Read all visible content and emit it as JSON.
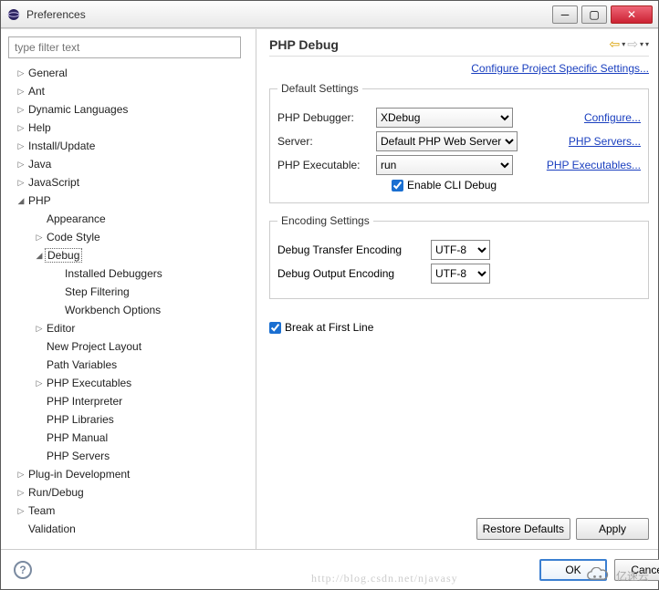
{
  "window": {
    "title": "Preferences"
  },
  "filter": {
    "placeholder": "type filter text"
  },
  "tree": [
    {
      "label": "General",
      "depth": 0,
      "arrow": "▷"
    },
    {
      "label": "Ant",
      "depth": 0,
      "arrow": "▷"
    },
    {
      "label": "Dynamic Languages",
      "depth": 0,
      "arrow": "▷"
    },
    {
      "label": "Help",
      "depth": 0,
      "arrow": "▷"
    },
    {
      "label": "Install/Update",
      "depth": 0,
      "arrow": "▷"
    },
    {
      "label": "Java",
      "depth": 0,
      "arrow": "▷"
    },
    {
      "label": "JavaScript",
      "depth": 0,
      "arrow": "▷"
    },
    {
      "label": "PHP",
      "depth": 0,
      "arrow": "◢"
    },
    {
      "label": "Appearance",
      "depth": 1,
      "arrow": ""
    },
    {
      "label": "Code Style",
      "depth": 1,
      "arrow": "▷"
    },
    {
      "label": "Debug",
      "depth": 1,
      "arrow": "◢",
      "selected": true
    },
    {
      "label": "Installed Debuggers",
      "depth": 2,
      "arrow": ""
    },
    {
      "label": "Step Filtering",
      "depth": 2,
      "arrow": ""
    },
    {
      "label": "Workbench Options",
      "depth": 2,
      "arrow": ""
    },
    {
      "label": "Editor",
      "depth": 1,
      "arrow": "▷"
    },
    {
      "label": "New Project Layout",
      "depth": 1,
      "arrow": ""
    },
    {
      "label": "Path Variables",
      "depth": 1,
      "arrow": ""
    },
    {
      "label": "PHP Executables",
      "depth": 1,
      "arrow": "▷"
    },
    {
      "label": "PHP Interpreter",
      "depth": 1,
      "arrow": ""
    },
    {
      "label": "PHP Libraries",
      "depth": 1,
      "arrow": ""
    },
    {
      "label": "PHP Manual",
      "depth": 1,
      "arrow": ""
    },
    {
      "label": "PHP Servers",
      "depth": 1,
      "arrow": ""
    },
    {
      "label": "Plug-in Development",
      "depth": 0,
      "arrow": "▷"
    },
    {
      "label": "Run/Debug",
      "depth": 0,
      "arrow": "▷"
    },
    {
      "label": "Team",
      "depth": 0,
      "arrow": "▷"
    },
    {
      "label": "Validation",
      "depth": 0,
      "arrow": ""
    }
  ],
  "main": {
    "title": "PHP Debug",
    "project_link": "Configure Project Specific Settings...",
    "default_settings": {
      "legend": "Default Settings",
      "debugger_label": "PHP Debugger:",
      "debugger_value": "XDebug",
      "debugger_link": "Configure...",
      "server_label": "Server:",
      "server_value": "Default PHP Web Server",
      "server_link": "PHP Servers...",
      "exe_label": "PHP Executable:",
      "exe_value": "run",
      "exe_link": "PHP Executables...",
      "enable_cli_label": "Enable CLI Debug",
      "enable_cli_checked": true
    },
    "encoding": {
      "legend": "Encoding Settings",
      "transfer_label": "Debug Transfer Encoding",
      "transfer_value": "UTF-8",
      "output_label": "Debug Output Encoding",
      "output_value": "UTF-8"
    },
    "break_first_label": "Break at First Line",
    "break_first_checked": true,
    "restore_btn": "Restore Defaults",
    "apply_btn": "Apply"
  },
  "footer": {
    "ok": "OK",
    "cancel": "Cancel"
  },
  "watermark": {
    "text": "亿速云",
    "faded": "http://blog.csdn.net/njavasy"
  }
}
